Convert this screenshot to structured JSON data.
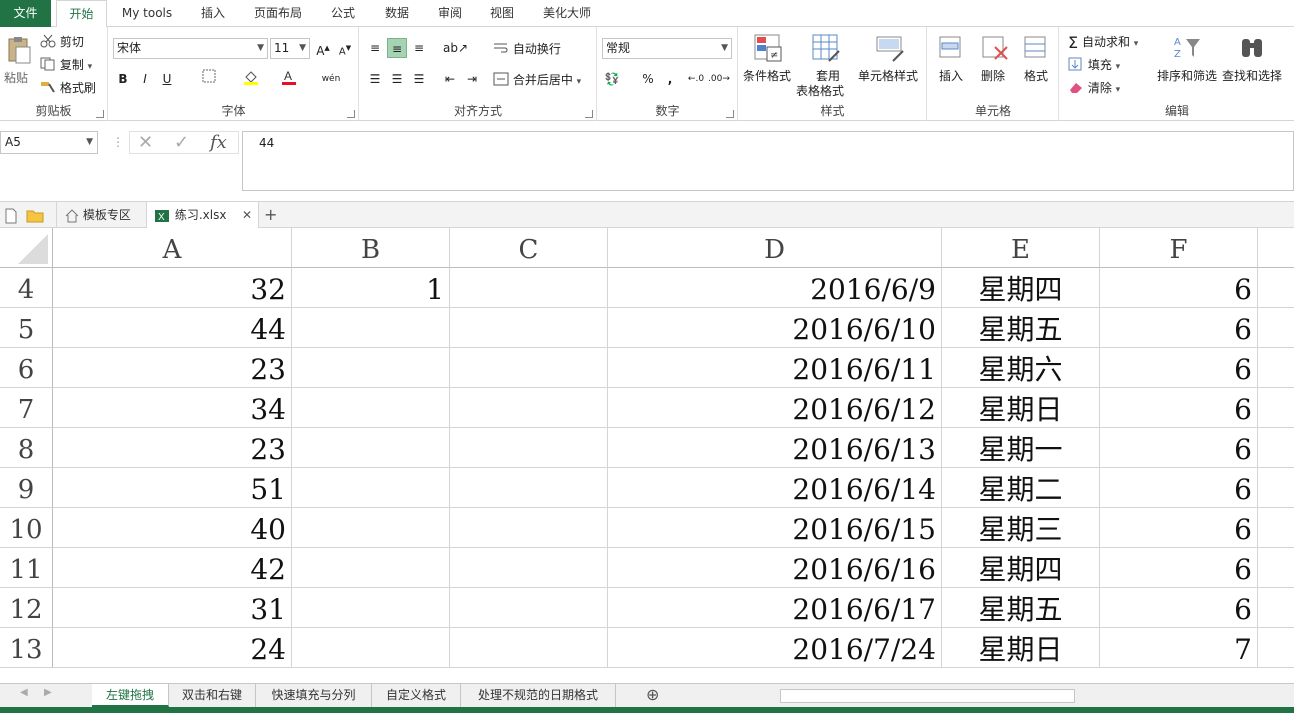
{
  "ribbon_tabs": [
    "文件",
    "开始",
    "My tools",
    "插入",
    "页面布局",
    "公式",
    "数据",
    "审阅",
    "视图",
    "美化大师"
  ],
  "clipboard": {
    "paste": "粘贴",
    "cut": "剪切",
    "copy": "复制",
    "format_painter": "格式刷",
    "label": "剪贴板"
  },
  "font": {
    "name": "宋体",
    "size": "11",
    "bold": "B",
    "italic": "I",
    "underline": "U",
    "label": "字体"
  },
  "alignment": {
    "wrap": "自动换行",
    "merge": "合并后居中",
    "label": "对齐方式"
  },
  "number": {
    "format": "常规",
    "percent": "%",
    "comma": ",",
    "label": "数字"
  },
  "styles": {
    "conditional": "条件格式",
    "table1": "套用",
    "table2": "表格格式",
    "cell_styles": "单元格样式",
    "label": "样式"
  },
  "cells": {
    "insert": "插入",
    "delete": "删除",
    "format": "格式",
    "label": "单元格"
  },
  "editing": {
    "autosum": "自动求和",
    "fill": "填充",
    "clear": "清除",
    "sort": "排序和筛选",
    "find": "查找和选择",
    "label": "编辑"
  },
  "formula_bar": {
    "name_box": "A5",
    "value": "44"
  },
  "doc_tabs": {
    "template": "模板专区",
    "file": "练习.xlsx"
  },
  "columns": [
    "A",
    "B",
    "C",
    "D",
    "E",
    "F"
  ],
  "rows": [
    {
      "num": "4",
      "A": "32",
      "B": "1",
      "C": "",
      "D": "2016/6/9",
      "E": "星期四",
      "F": "6"
    },
    {
      "num": "5",
      "A": "44",
      "B": "",
      "C": "",
      "D": "2016/6/10",
      "E": "星期五",
      "F": "6"
    },
    {
      "num": "6",
      "A": "23",
      "B": "",
      "C": "",
      "D": "2016/6/11",
      "E": "星期六",
      "F": "6"
    },
    {
      "num": "7",
      "A": "34",
      "B": "",
      "C": "",
      "D": "2016/6/12",
      "E": "星期日",
      "F": "6"
    },
    {
      "num": "8",
      "A": "23",
      "B": "",
      "C": "",
      "D": "2016/6/13",
      "E": "星期一",
      "F": "6"
    },
    {
      "num": "9",
      "A": "51",
      "B": "",
      "C": "",
      "D": "2016/6/14",
      "E": "星期二",
      "F": "6"
    },
    {
      "num": "10",
      "A": "40",
      "B": "",
      "C": "",
      "D": "2016/6/15",
      "E": "星期三",
      "F": "6"
    },
    {
      "num": "11",
      "A": "42",
      "B": "",
      "C": "",
      "D": "2016/6/16",
      "E": "星期四",
      "F": "6"
    },
    {
      "num": "12",
      "A": "31",
      "B": "",
      "C": "",
      "D": "2016/6/17",
      "E": "星期五",
      "F": "6"
    },
    {
      "num": "13",
      "A": "24",
      "B": "",
      "C": "",
      "D": "2016/7/24",
      "E": "星期日",
      "F": "7"
    }
  ],
  "sheet_tabs": [
    "左键拖拽",
    "双击和右键",
    "快速填充与分列",
    "自定义格式",
    "处理不规范的日期格式"
  ],
  "colors": {
    "accent": "#217346",
    "font_color": "#e81123",
    "highlight": "#ffff00"
  }
}
